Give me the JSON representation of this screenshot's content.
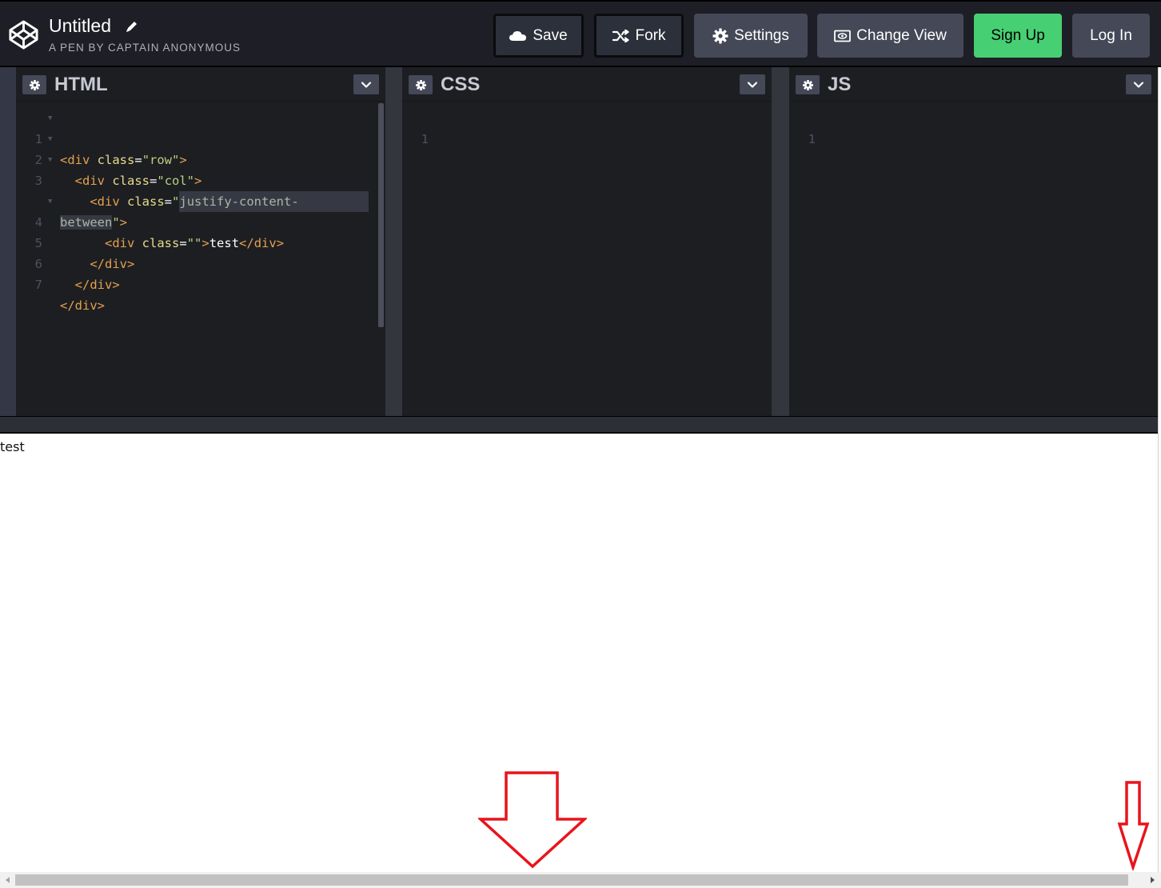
{
  "header": {
    "title": "Untitled",
    "subtitle": "A PEN BY CAPTAIN ANONYMOUS",
    "buttons": {
      "save": "Save",
      "fork": "Fork",
      "settings": "Settings",
      "change_view": "Change View",
      "sign_up": "Sign Up",
      "log_in": "Log In"
    }
  },
  "colors": {
    "header_bg": "#1e1f26",
    "editor_bg": "#1d1e22",
    "button_gray": "#444857",
    "sign_up_green": "#47cf73",
    "annotation_red": "#e8141b"
  },
  "editors": {
    "html": {
      "title": "HTML",
      "lines": [
        {
          "num": "1",
          "fold": true
        },
        {
          "num": "2",
          "fold": true
        },
        {
          "num": "3",
          "fold": true
        },
        {
          "num": "",
          "fold": false
        },
        {
          "num": "4",
          "fold": true
        },
        {
          "num": "5",
          "fold": false
        },
        {
          "num": "6",
          "fold": false
        },
        {
          "num": "7",
          "fold": false
        }
      ],
      "tokens": {
        "l1_open": "<div ",
        "l1_attr": "class",
        "l1_eq": "=",
        "l1_val": "\"row\"",
        "l1_close": ">",
        "l2_indent": "  ",
        "l2_open": "<div ",
        "l2_attr": "class",
        "l2_eq": "=",
        "l2_val": "\"col\"",
        "l2_close": ">",
        "l3_indent": "    ",
        "l3_open": "<div ",
        "l3_attr": "class",
        "l3_eq": "=",
        "l3_q": "\"",
        "l3_val": "justify-content-",
        "l3b_val": "between",
        "l3b_q": "\"",
        "l3b_close": ">",
        "l4_indent": "      ",
        "l4_open": "<div ",
        "l4_attr": "class",
        "l4_eq": "=",
        "l4_val": "\"\"",
        "l4_close": ">",
        "l4_text": "test",
        "l4_end": "</div>",
        "l5_indent": "    ",
        "l5_end": "</div>",
        "l6_indent": "  ",
        "l6_end": "</div>",
        "l7_end": "</div>"
      }
    },
    "css": {
      "title": "CSS",
      "line_number": "1"
    },
    "js": {
      "title": "JS",
      "line_number": "1"
    }
  },
  "preview": {
    "text": "test"
  },
  "icons": {
    "logo": "codepen-logo-icon",
    "pencil": "pencil-icon",
    "cloud": "cloud-icon",
    "fork": "fork-icon",
    "gear": "gear-icon",
    "view": "change-view-icon",
    "chevron": "chevron-down-icon",
    "annotation_arrow": "annotation-arrow-down-icon"
  }
}
